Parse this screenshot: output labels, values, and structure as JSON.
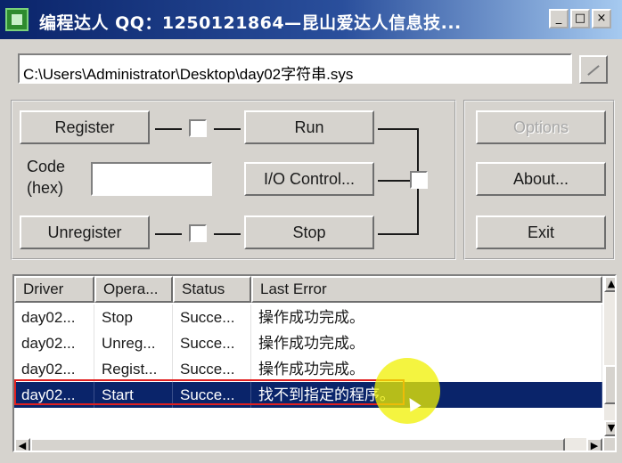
{
  "window": {
    "title": "编程达人 QQ：1250121864—昆山爱达人信息技...",
    "controls": {
      "minimize": "_",
      "maximize": "□",
      "close": "×"
    }
  },
  "path": {
    "value": "C:\\Users\\Administrator\\Desktop\\day02字符串.sys"
  },
  "buttons": {
    "register": "Register",
    "run": "Run",
    "io_control": "I/O Control...",
    "unregister": "Unregister",
    "stop": "Stop",
    "options": "Options",
    "about": "About...",
    "exit": "Exit"
  },
  "code_label": {
    "line1": "Code",
    "line2": "(hex)"
  },
  "code_field": {
    "value": ""
  },
  "table": {
    "columns": [
      "Driver",
      "Opera...",
      "Status",
      "Last Error"
    ],
    "rows": [
      [
        "day02...",
        "Stop",
        "Succe...",
        "操作成功完成。"
      ],
      [
        "day02...",
        "Unreg...",
        "Succe...",
        "操作成功完成。"
      ],
      [
        "day02...",
        "Regist...",
        "Succe...",
        "操作成功完成。"
      ],
      [
        "day02...",
        "Start",
        "Succe...",
        "找不到指定的程序。"
      ]
    ],
    "selected_row": 3
  },
  "scrollbar": {
    "up": "▲",
    "down": "▼",
    "left": "◀",
    "right": "▶"
  },
  "icons": {
    "app": "app-icon",
    "browse": "browse-icon"
  },
  "colors": {
    "selection": "#0a246a",
    "title_start": "#0a246a",
    "title_end": "#a6caf0",
    "highlight": "#e02020"
  }
}
